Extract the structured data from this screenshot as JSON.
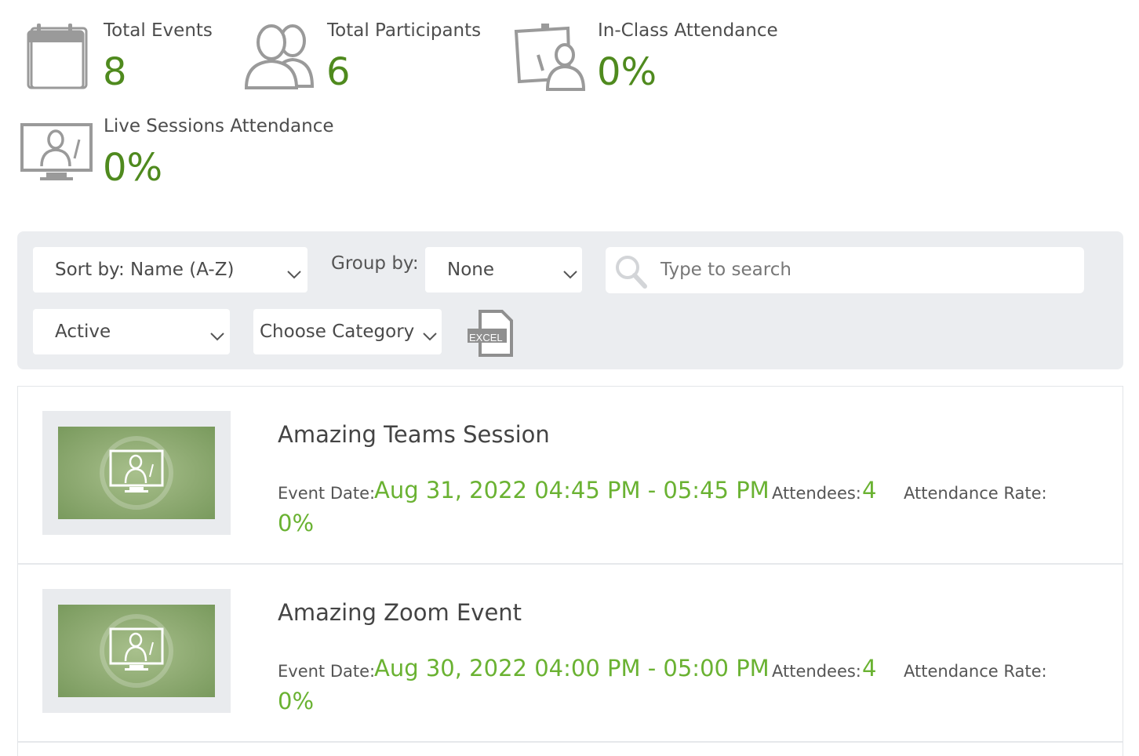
{
  "stats": {
    "total_events": {
      "label": "Total Events",
      "value": "8"
    },
    "total_participants": {
      "label": "Total Participants",
      "value": "6"
    },
    "in_class_attendance": {
      "label": "In-Class Attendance",
      "value": "0%"
    },
    "live_sessions_attendance": {
      "label": "Live Sessions Attendance",
      "value": "0%"
    }
  },
  "filters": {
    "sort_by": "Sort by: Name (A-Z)",
    "group_by_label": "Group by:",
    "group_by": "None",
    "search_placeholder": "Type to search",
    "status": "Active",
    "category": "Choose Category",
    "excel_label": "EXCEL"
  },
  "labels": {
    "event_date": "Event Date:",
    "attendees": "Attendees:",
    "attendance_rate": "Attendance Rate:"
  },
  "events": [
    {
      "title": "Amazing Teams Session",
      "date": "Aug 31, 2022 04:45 PM - 05:45 PM",
      "attendees": "4",
      "attendance_rate": "0%"
    },
    {
      "title": "Amazing Zoom Event",
      "date": "Aug 30, 2022 04:00 PM - 05:00 PM",
      "attendees": "4",
      "attendance_rate": "0%"
    }
  ],
  "colors": {
    "accent_dark": "#4f8a1e",
    "accent": "#6ab232",
    "panel": "#ebedf0"
  }
}
